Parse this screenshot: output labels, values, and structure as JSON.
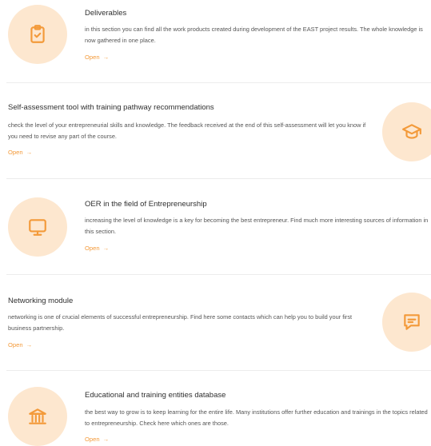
{
  "items": [
    {
      "title": "Deliverables",
      "description": "in this section you can find all the work products created during development of the EAST project results. The whole knowledge is now gathered in one place.",
      "link_label": "Open",
      "icon": "clipboard-check-icon"
    },
    {
      "title": "Self-assessment tool with training pathway recommendations",
      "description": "check the level of your entrepreneurial skills and knowledge. The feedback received at the end of this self-assessment will let you know if you need to revise any part of the course.",
      "link_label": "Open",
      "icon": "graduation-cap-icon"
    },
    {
      "title": "OER in the field of Entrepreneurship",
      "description": "increasing the level of knowledge is a key for becoming the best entrepreneur. Find much more interesting sources of information in this section.",
      "link_label": "Open",
      "icon": "monitor-icon"
    },
    {
      "title": "Networking module",
      "description": "networking is one of crucial elements of successful entrepreneurship. Find here some contacts which can help you to build your first business partnership.",
      "link_label": "Open",
      "icon": "chat-message-icon"
    },
    {
      "title": "Educational and training entities database",
      "description": "the best way to grow is to keep learning for the entire life. Many institutions offer further education and trainings in the topics related to entrepreneurship. Check here which ones are those.",
      "link_label": "Open",
      "icon": "institution-building-icon"
    }
  ],
  "colors": {
    "accent": "#f39a3a",
    "circle_bg": "#fde7cf",
    "divider": "#ececec"
  }
}
